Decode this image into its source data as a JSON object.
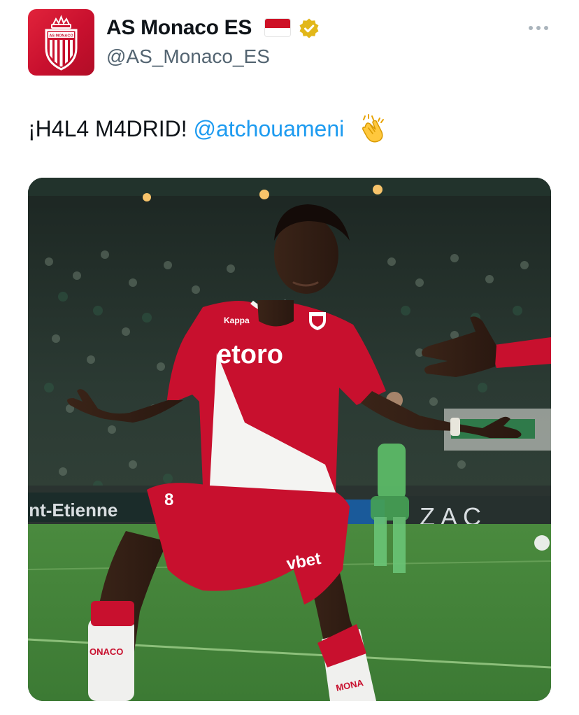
{
  "account": {
    "display_name": "AS Monaco ES",
    "handle": "@AS_Monaco_ES",
    "verified": true,
    "flag": "Monaco flag",
    "avatar": "AS Monaco crest",
    "avatar_text": "AS MONACO"
  },
  "tweet": {
    "text_prefix": "¡H4L4 M4DRID!",
    "mention": "@atchouameni",
    "emoji": "clapping-hands-icon"
  },
  "media": {
    "description_icon": "player-celebration-photo",
    "jersey_sponsor": "etoro",
    "shorts_sponsor": "vbet",
    "shirt_number": "8",
    "board_left": "int-Etienne",
    "board_right": "ZAC",
    "sock_text_left": "ONACO",
    "sock_text_right": "MONA",
    "kit_brand": "Kappa"
  },
  "colors": {
    "monaco_red": "#c8102e",
    "link_blue": "#1d9bf0",
    "verified_gold": "#e2b719",
    "handle_gray": "#536471"
  }
}
